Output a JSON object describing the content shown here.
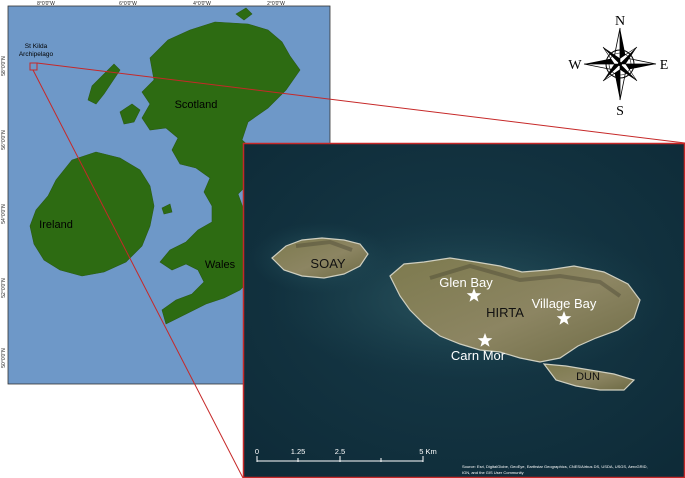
{
  "overview_map": {
    "longitude_labels": [
      "8°0'0\"W",
      "6°0'0\"W",
      "4°0'0\"W",
      "2°0'0\"W"
    ],
    "latitude_labels": [
      "58°0'0\"N",
      "56°0'0\"N",
      "54°0'0\"N",
      "52°0'0\"N",
      "50°0'0\"N"
    ],
    "place_labels": {
      "scotland": "Scotland",
      "ireland": "Ireland",
      "wales": "Wales",
      "st_kilda_line1": "St Kilda",
      "st_kilda_line2": "Archipelago"
    },
    "colors": {
      "sea": "#6e98c8",
      "land": "#2d6b12",
      "inset_frame": "#c62828"
    }
  },
  "compass": {
    "north": "N",
    "south": "S",
    "east": "E",
    "west": "W"
  },
  "inset_map": {
    "islands": {
      "soay": "SOAY",
      "hirta": "HIRTA",
      "dun": "DUN"
    },
    "sites": [
      {
        "label": "Glen Bay",
        "marker": "star-icon"
      },
      {
        "label": "Village Bay",
        "marker": "star-icon"
      },
      {
        "label": "Carn Mor",
        "marker": "star-icon"
      }
    ],
    "scale_bar": {
      "ticks": [
        "0",
        "1.25",
        "2.5",
        "5 Km"
      ]
    },
    "attribution": {
      "line1": "Source: Esri, DigitalGlobe, GeoEye, Earthstar Geographics, CNES/Airbus DS, USDA, USGS, AeroGRID,",
      "line2": "IGN, and the GIS User Community"
    }
  }
}
